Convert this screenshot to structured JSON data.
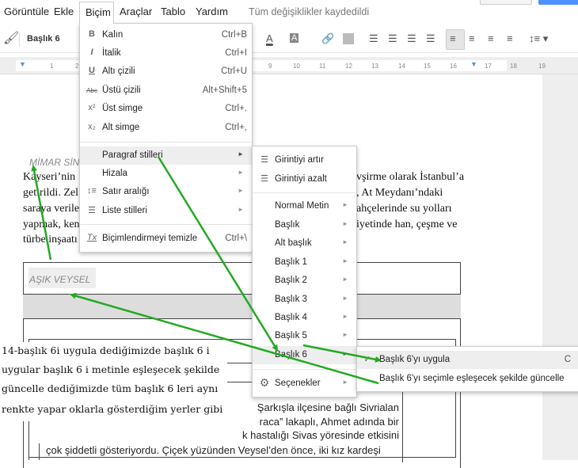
{
  "menubar": {
    "items": [
      "Görüntüle",
      "Ekle",
      "Biçim",
      "Araçlar",
      "Tablo",
      "Yardım"
    ],
    "status": "Tüm değişiklikler kaydedildi"
  },
  "toolbar": {
    "style": "Başlık 6",
    "text_color_icon": "A",
    "highlight_icon": "A"
  },
  "ruler": {
    "numbers": [
      "1",
      "2",
      "9",
      "10",
      "11",
      "12",
      "13",
      "14",
      "15",
      "16",
      "17",
      "18",
      "19"
    ]
  },
  "format_menu": {
    "items": [
      {
        "icon": "B",
        "label": "Kalın",
        "shortcut": "Ctrl+B"
      },
      {
        "icon": "I",
        "label": "İtalik",
        "shortcut": "Ctrl+I"
      },
      {
        "icon": "U",
        "label": "Altı çizili",
        "shortcut": "Ctrl+U"
      },
      {
        "icon": "Abc",
        "label": "Üstü çizili",
        "shortcut": "Alt+Shift+5"
      },
      {
        "icon": "x²",
        "label": "Üst simge",
        "shortcut": "Ctrl+."
      },
      {
        "icon": "x₂",
        "label": "Alt simge",
        "shortcut": "Ctrl+,"
      },
      {
        "label": "Paragraf stilleri"
      },
      {
        "label": "Hizala"
      },
      {
        "label": "Satır aralığı"
      },
      {
        "label": "Liste stilleri"
      },
      {
        "icon": "Tx",
        "label": "Biçimlendirmeyi temizle",
        "shortcut": "Ctrl+\\"
      }
    ]
  },
  "paragraph_submenu": {
    "items": [
      "Girintiyi artır",
      "Girintiyi azalt",
      "Normal Metin",
      "Başlık",
      "Alt başlık",
      "Başlık 1",
      "Başlık 2",
      "Başlık 3",
      "Başlık 4",
      "Başlık 5",
      "Başlık 6",
      "Seçenekler"
    ]
  },
  "heading6_submenu": {
    "apply": "Başlık 6'yı uygula",
    "apply_shortcut": "C",
    "update": "Başlık 6'yı seçimle eşleşecek şekilde güncelle"
  },
  "document": {
    "heading1": "MİMAR SİN",
    "para_left": [
      "Kayseri’nin",
      "getirildi. Zel",
      "saraya verile",
      "yapmak, ken",
      "türbe inşaatı"
    ],
    "para_right": [
      "vşirme olarak İstanbul’a",
      ", At Meydanı’ndaki",
      "ahçelerinde su yolları",
      "iyetinde han, çeşme ve"
    ],
    "heading2": "AŞIK VEYSEL",
    "body_lines": [
      "Şarkışla ilçesine bağlı Sivrialan",
      "raca” lakaplı, Ahmet adında bir",
      "k hastalığı Sivas yöresinde etkisini",
      "çok şiddetli gösteriyordu. Çiçek yüzünden Veysel’den önce, iki kız kardeşi"
    ]
  },
  "annotation": {
    "lines": [
      "14-başlık 6i uygula dediğimizde başlık 6 i",
      "uygular başlık 6 i metinle  eşleşecek şekilde",
      "güncelle dediğimizde tüm başlık 6 leri aynı",
      "renkte yapar oklarla gösterdiğim yerler gibi"
    ]
  },
  "colors": {
    "arrow": "#22aa22",
    "menu_highlight": "#eeeeee",
    "primary_button": "#4d90fe"
  }
}
